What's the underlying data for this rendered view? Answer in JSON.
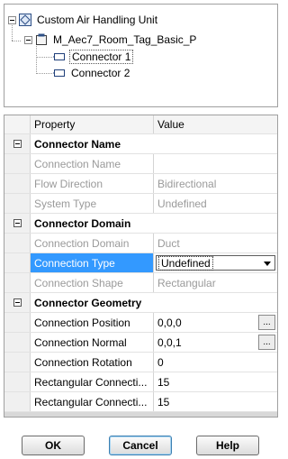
{
  "tree": {
    "root_label": "Custom Air Handling Unit",
    "child_label": "M_Aec7_Room_Tag_Basic_P",
    "connectors": [
      "Connector 1",
      "Connector 2"
    ]
  },
  "grid": {
    "header": {
      "property": "Property",
      "value": "Value"
    },
    "rows": [
      {
        "type": "category",
        "label": "Connector Name"
      },
      {
        "type": "property",
        "label": "Connection Name",
        "value": "",
        "disabled": true
      },
      {
        "type": "property",
        "label": "Flow Direction",
        "value": "Bidirectional",
        "disabled": true
      },
      {
        "type": "property",
        "label": "System Type",
        "value": "Undefined",
        "disabled": true
      },
      {
        "type": "category",
        "label": "Connector Domain"
      },
      {
        "type": "property",
        "label": "Connection Domain",
        "value": "Duct",
        "disabled": true
      },
      {
        "type": "property",
        "label": "Connection Type",
        "value": "Undefined",
        "selected": true,
        "editor": "dropdown"
      },
      {
        "type": "property",
        "label": "Connection Shape",
        "value": "Rectangular",
        "disabled": true
      },
      {
        "type": "category",
        "label": "Connector Geometry"
      },
      {
        "type": "property",
        "label": "Connection Position",
        "value": "0,0,0",
        "editor": "ellipsis"
      },
      {
        "type": "property",
        "label": "Connection Normal",
        "value": "0,0,1",
        "editor": "ellipsis"
      },
      {
        "type": "property",
        "label": "Connection Rotation",
        "value": "0"
      },
      {
        "type": "property",
        "label": "Rectangular Connecti...",
        "value": "15"
      },
      {
        "type": "property",
        "label": "Rectangular Connecti...",
        "value": "15"
      }
    ],
    "ellipsis_label": "..."
  },
  "buttons": {
    "ok": "OK",
    "cancel": "Cancel",
    "help": "Help"
  }
}
